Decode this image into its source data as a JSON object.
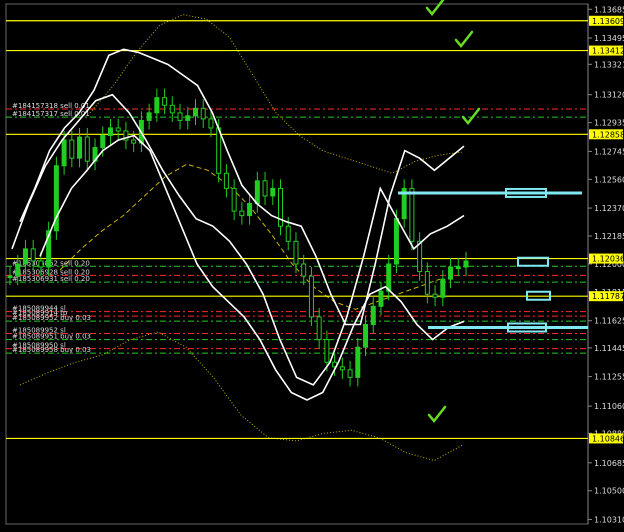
{
  "chart_data": {
    "type": "candlestick",
    "background": "#000000",
    "colors": {
      "candle": "#22cc22",
      "bands": "#ffffff",
      "ma": "#c8b400",
      "level": "#ffff00",
      "level_label_bg": "#ffff00",
      "order_red": "#ff2a2a",
      "order_green": "#22cc22",
      "zone": "#7fe8f0",
      "check": "#66dd22",
      "axis_text": "#dddddd"
    },
    "ylim": [
      1.1028,
      1.1372
    ],
    "y_ticks": [
      "1.13685",
      "1.13495",
      "1.13321",
      "1.13120",
      "1.12935",
      "1.12745",
      "1.12560",
      "1.12370",
      "1.12185",
      "1.12000",
      "1.11815",
      "1.11625",
      "1.11445",
      "1.11255",
      "1.11060",
      "1.10880",
      "1.10685",
      "1.10500",
      "1.10310"
    ],
    "level_labels": [
      {
        "value": 1.13609,
        "label": "1.13609"
      },
      {
        "value": 1.13412,
        "label": "1.13412"
      },
      {
        "value": 1.12858,
        "label": "1.12858"
      },
      {
        "value": 1.12036,
        "label": "1.12036"
      },
      {
        "value": 1.11787,
        "label": "1.11787"
      },
      {
        "value": 1.10846,
        "label": "1.10846"
      }
    ],
    "orders": [
      {
        "text": "#184157318 sell 0.01",
        "value": 1.13025,
        "color": "red"
      },
      {
        "text": "#184157317 sell 0.01",
        "value": 1.12972,
        "color": "green"
      },
      {
        "text": "#185306862 sell 0.20",
        "value": 1.11985,
        "color": "green"
      },
      {
        "text": "#185306928 sell 0.20",
        "value": 1.11925,
        "color": "red"
      },
      {
        "text": "#185306931 sell 0.20",
        "value": 1.1188,
        "color": "green"
      },
      {
        "text": "#185089944 sl",
        "value": 1.11685,
        "color": "red"
      },
      {
        "text": "#185089914 tp",
        "value": 1.11655,
        "color": "red"
      },
      {
        "text": "#185089952 buy 0.03",
        "value": 1.11622,
        "color": "green"
      },
      {
        "text": "#185089952 sl",
        "value": 1.1154,
        "color": "red"
      },
      {
        "text": "#185089951 buy 0.03",
        "value": 1.115,
        "color": "green"
      },
      {
        "text": "#185089950 sl",
        "value": 1.1144,
        "color": "red"
      },
      {
        "text": "#185089958 buy 0.03",
        "value": 1.1141,
        "color": "green"
      }
    ],
    "close_series": [
      1.1192,
      1.12,
      1.121,
      1.1202,
      1.1198,
      1.1222,
      1.1265,
      1.1282,
      1.127,
      1.1284,
      1.1268,
      1.1277,
      1.1285,
      1.129,
      1.1288,
      1.1282,
      1.128,
      1.1295,
      1.13,
      1.131,
      1.1305,
      1.13,
      1.1295,
      1.1298,
      1.1303,
      1.1296,
      1.129,
      1.126,
      1.125,
      1.1235,
      1.1232,
      1.124,
      1.1255,
      1.1245,
      1.125,
      1.1225,
      1.1215,
      1.12,
      1.1192,
      1.1165,
      1.115,
      1.1135,
      1.1132,
      1.113,
      1.1125,
      1.1145,
      1.116,
      1.1172,
      1.1182,
      1.12,
      1.123,
      1.125,
      1.1215,
      1.1195,
      1.118,
      1.1178,
      1.119,
      1.1198,
      1.1198,
      1.1202
    ],
    "upper_band": [
      1.1228,
      1.125,
      1.1275,
      1.129,
      1.13,
      1.1315,
      1.1338,
      1.1342,
      1.134,
      1.1336,
      1.1332,
      1.1325,
      1.1318,
      1.13,
      1.1275,
      1.1252,
      1.124,
      1.1232,
      1.1228,
      1.1225,
      1.1205,
      1.118,
      1.116,
      1.116,
      1.12,
      1.1245,
      1.1275,
      1.127,
      1.1262,
      1.127,
      1.1278
    ],
    "lower_band": [
      1.1205,
      1.123,
      1.125,
      1.1262,
      1.1275,
      1.1282,
      1.1285,
      1.1275,
      1.125,
      1.1225,
      1.12,
      1.1185,
      1.1175,
      1.1165,
      1.115,
      1.113,
      1.1115,
      1.111,
      1.1115,
      1.1135,
      1.116,
      1.118,
      1.1185,
      1.1175,
      1.116,
      1.115,
      1.1158,
      1.1162
    ],
    "middle_band": [
      1.121,
      1.124,
      1.1265,
      1.1282,
      1.1295,
      1.1308,
      1.1312,
      1.13,
      1.1282,
      1.1262,
      1.1245,
      1.123,
      1.1225,
      1.1215,
      1.12,
      1.118,
      1.115,
      1.1125,
      1.112,
      1.1135,
      1.1165,
      1.1205,
      1.125,
      1.123,
      1.121,
      1.122,
      1.1225,
      1.1232
    ],
    "ma_slow": [
      1.1196,
      1.121,
      1.1222,
      1.1232,
      1.1245,
      1.1258,
      1.1266,
      1.1262,
      1.1252,
      1.1238,
      1.122,
      1.12,
      1.1185,
      1.1175,
      1.117,
      1.1175,
      1.118,
      1.1185,
      1.119
    ],
    "upper_envelope": [
      1.13,
      1.1318,
      1.134,
      1.1358,
      1.1365,
      1.1362,
      1.135,
      1.1325,
      1.13,
      1.1285,
      1.1275,
      1.127,
      1.1265,
      1.126,
      1.1268,
      1.1272,
      1.1274
    ],
    "lower_envelope": [
      1.112,
      1.1128,
      1.1135,
      1.114,
      1.115,
      1.1155,
      1.1145,
      1.1125,
      1.11,
      1.1085,
      1.1083,
      1.1088,
      1.109,
      1.1085,
      1.1075,
      1.107,
      1.108
    ],
    "zones": [
      {
        "value": 1.1247,
        "kind": "line"
      },
      {
        "value": 1.12015,
        "kind": "box"
      },
      {
        "value": 1.1179,
        "kind": "box"
      },
      {
        "value": 1.1158,
        "kind": "line"
      }
    ],
    "checkmarks": 4
  }
}
